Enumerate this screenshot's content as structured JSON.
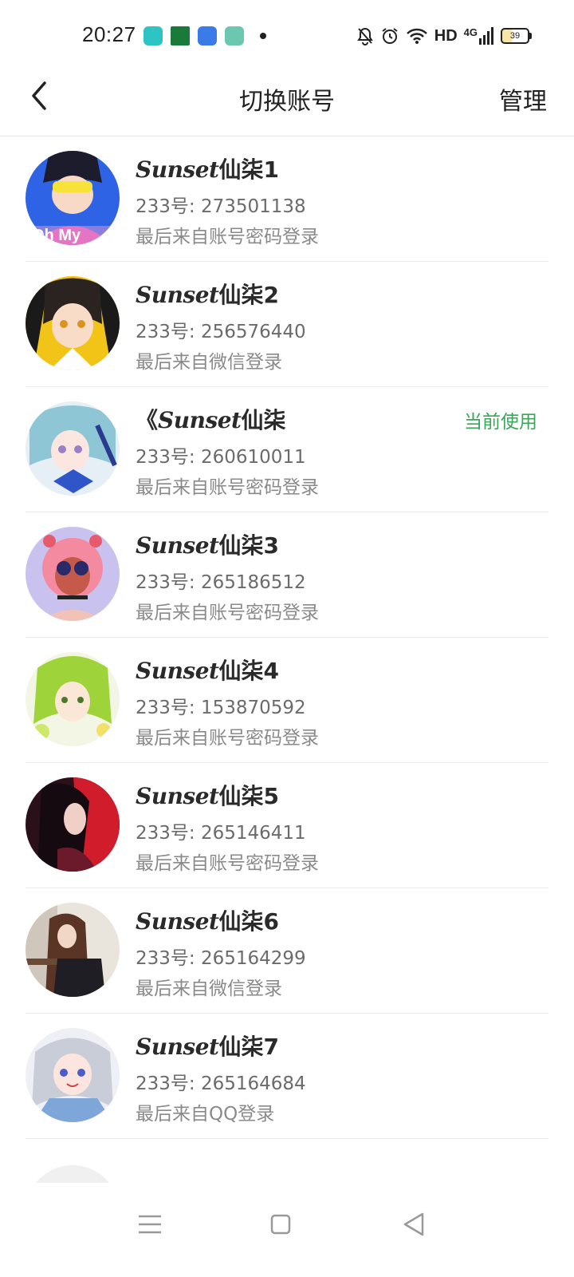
{
  "status_bar": {
    "time": "20:27",
    "network_label": "HD",
    "network_type": "4G",
    "battery_level": "39",
    "icons": [
      "notification-muted-icon",
      "alarm-icon",
      "wifi-icon",
      "signal-icon",
      "battery-icon"
    ],
    "app_icon_colors": [
      "#2ec4c4",
      "#1a7a3a",
      "#3b7be8",
      "#6cc7b0"
    ]
  },
  "header": {
    "title": "切换账号",
    "manage_label": "管理",
    "back_icon": "chevron-left-icon"
  },
  "accounts": [
    {
      "name_script": "Sunset",
      "name_suffix": "仙柒1",
      "id_line": "233号: 273501138",
      "login": "最后来自账号密码登录",
      "current": ""
    },
    {
      "name_script": "Sunset",
      "name_suffix": "仙柒2",
      "id_line": "233号: 256576440",
      "login": "最后来自微信登录",
      "current": ""
    },
    {
      "name_prefix": "《",
      "name_script": "Sunset",
      "name_suffix": "仙柒",
      "id_line": "233号: 260610011",
      "login": "最后来自账号密码登录",
      "current": "当前使用"
    },
    {
      "name_script": "Sunset",
      "name_suffix": "仙柒3",
      "id_line": "233号: 265186512",
      "login": "最后来自账号密码登录",
      "current": ""
    },
    {
      "name_script": "Sunset",
      "name_suffix": "仙柒4",
      "id_line": "233号: 153870592",
      "login": "最后来自账号密码登录",
      "current": ""
    },
    {
      "name_script": "Sunset",
      "name_suffix": "仙柒5",
      "id_line": "233号: 265146411",
      "login": "最后来自账号密码登录",
      "current": ""
    },
    {
      "name_script": "Sunset",
      "name_suffix": "仙柒6",
      "id_line": "233号: 265164299",
      "login": "最后来自微信登录",
      "current": ""
    },
    {
      "name_script": "Sunset",
      "name_suffix": "仙柒7",
      "id_line": "233号: 265164684",
      "login": "最后来自QQ登录",
      "current": ""
    }
  ],
  "colors": {
    "current_badge": "#3aa657",
    "divider": "#ececec",
    "primary_text": "#222222",
    "secondary_text": "#6b6b6b"
  },
  "nav_bar": {
    "icons": [
      "menu-icon",
      "home-square-icon",
      "back-triangle-icon"
    ]
  }
}
